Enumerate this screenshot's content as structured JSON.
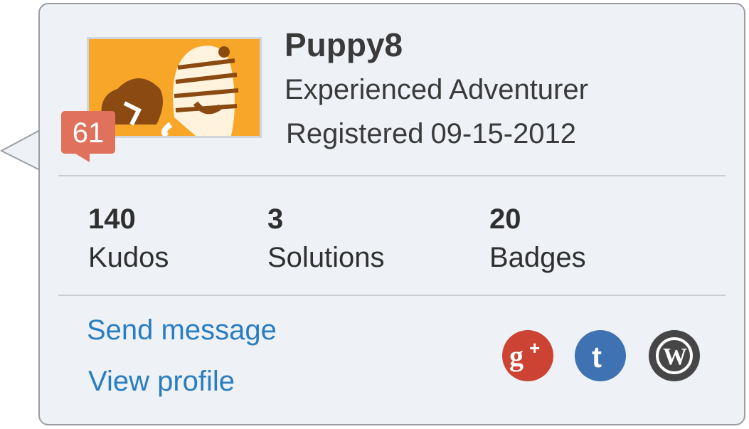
{
  "user": {
    "name": "Puppy8",
    "rank": "Experienced Adventurer",
    "registered_label": "Registered",
    "registered_date": "09-15-2012",
    "level": "61",
    "avatar_bg_color": "#f7a628"
  },
  "stats": [
    {
      "value": "140",
      "label": "Kudos"
    },
    {
      "value": "3",
      "label": "Solutions"
    },
    {
      "value": "20",
      "label": "Badges"
    }
  ],
  "actions": {
    "send_message": "Send message",
    "view_profile": "View profile"
  },
  "social": [
    {
      "icon": "google-plus-icon",
      "color": "#cc4233"
    },
    {
      "icon": "tumblr-icon",
      "color": "#3f72b2"
    },
    {
      "icon": "wordpress-icon",
      "color": "#464646"
    }
  ],
  "colors": {
    "card_bg": "#eef2f6",
    "link": "#2a7dc0",
    "badge": "#e0725d"
  }
}
